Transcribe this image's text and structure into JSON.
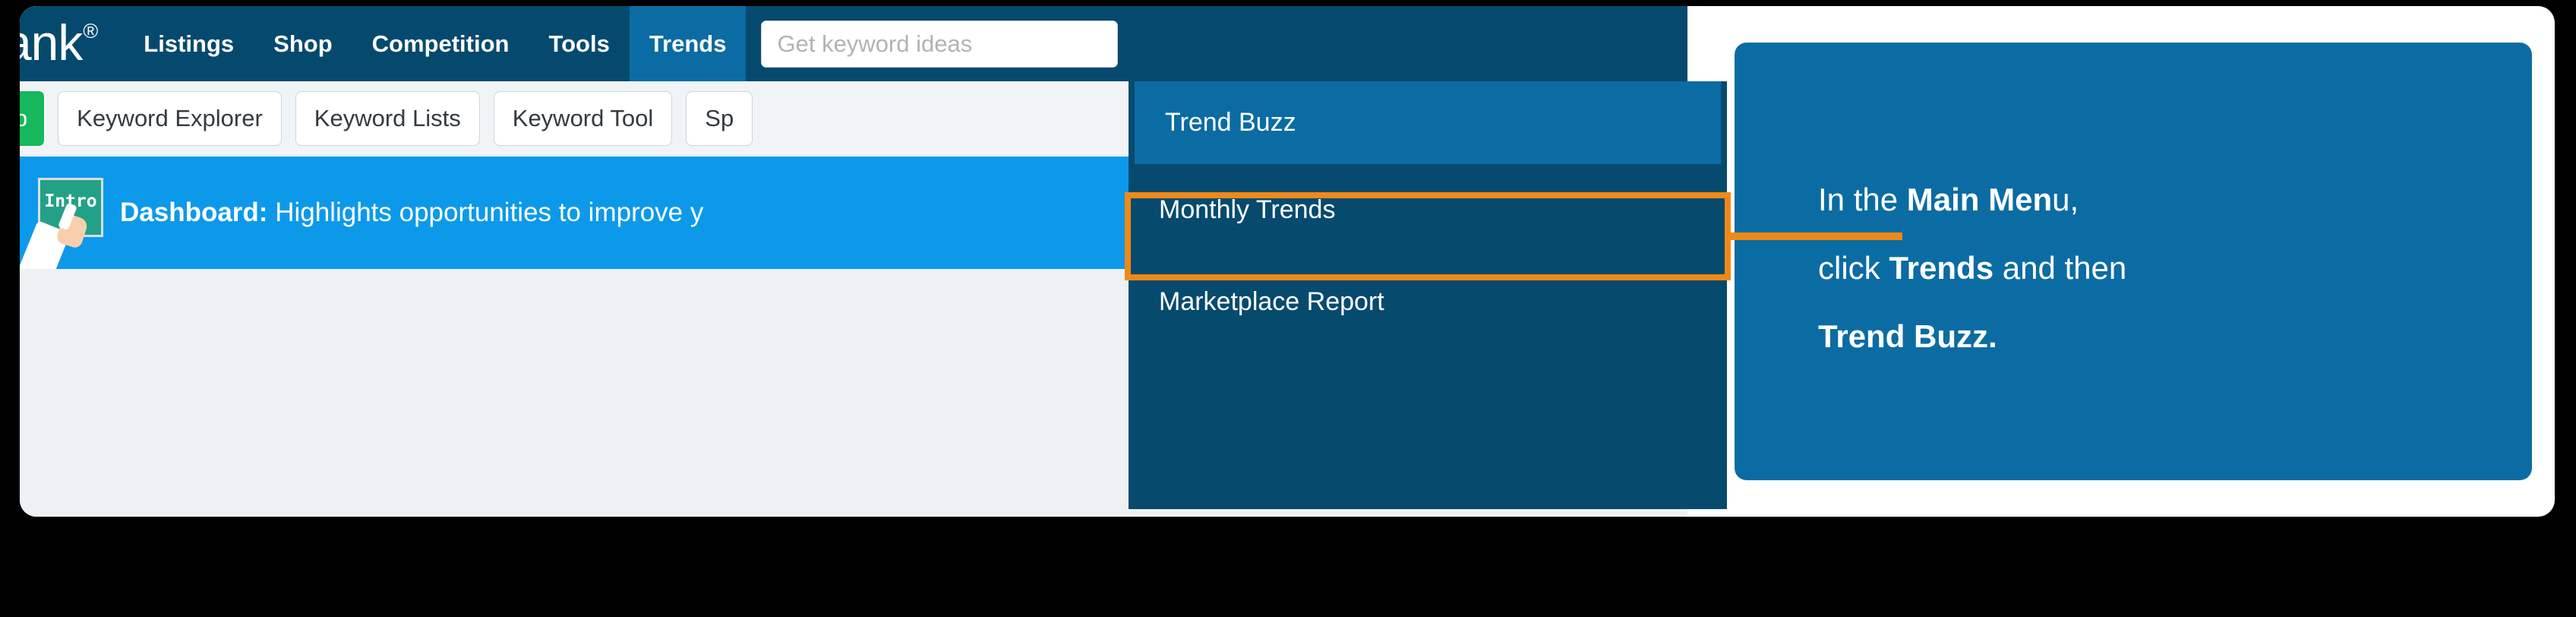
{
  "brand": {
    "logo_text": "rank",
    "logo_registered": "®",
    "nav_bg": "#054a6e",
    "accent_blue": "#0b6ca3",
    "banner_blue": "#0d99ea",
    "highlight_orange": "#f18918",
    "help_green": "#16b75d"
  },
  "nav": {
    "items": [
      {
        "label": "Listings",
        "active": false
      },
      {
        "label": "Shop",
        "active": false
      },
      {
        "label": "Competition",
        "active": false
      },
      {
        "label": "Tools",
        "active": false
      },
      {
        "label": "Trends",
        "active": true
      }
    ]
  },
  "search": {
    "placeholder": "Get keyword ideas",
    "value": ""
  },
  "toolbar": {
    "help_label": "lp",
    "buttons": [
      {
        "label": "Keyword Explorer"
      },
      {
        "label": "Keyword Lists"
      },
      {
        "label": "Keyword Tool"
      },
      {
        "label": "Sp"
      }
    ]
  },
  "banner": {
    "icon_name": "intro-chalkboard-icon",
    "icon_label": "Intro",
    "title": "Dashboard:",
    "description": "Highlights opportunities to improve y"
  },
  "dropdown": {
    "items": [
      {
        "label": "Trend Buzz",
        "highlighted": true
      },
      {
        "label": "Monthly Trends",
        "highlighted": false
      },
      {
        "label": "Marketplace Report",
        "highlighted": false
      }
    ]
  },
  "callout": {
    "line1_a": "In the ",
    "line1_b": "Main Men",
    "line1_c": "u,",
    "line2_a": "click ",
    "line2_b": "Trends",
    "line2_c": " and then",
    "line3_b": "Trend Buzz."
  }
}
